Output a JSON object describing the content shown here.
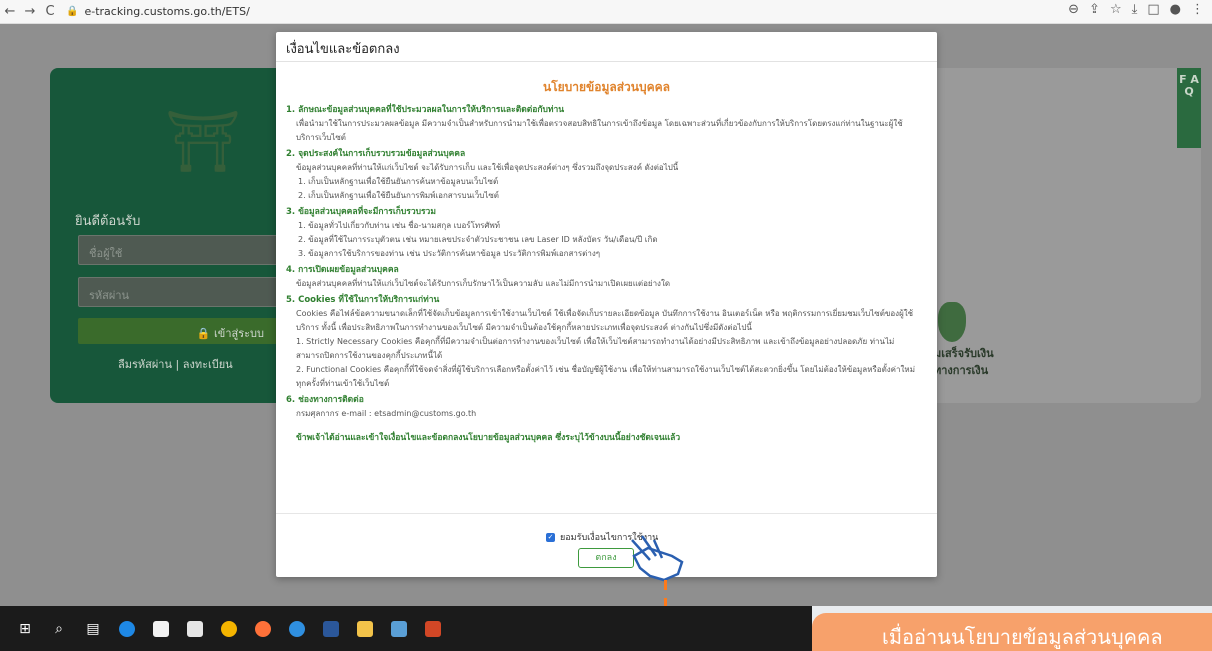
{
  "browser": {
    "back": "←",
    "forward": "→",
    "reload": "C",
    "lock": "🔒",
    "url": "e-tracking.customs.go.th/ETS/",
    "icons": [
      "⊖",
      "⇪",
      "☆",
      "⤓",
      "□",
      "●",
      "⋮"
    ]
  },
  "login": {
    "welcome": "ยินดีต้อนรับ",
    "username_placeholder": "ชื่อผู้ใช้",
    "password_placeholder": "รหัสผ่าน",
    "login_button": "🔒 เข้าสู่ระบบ",
    "forgot": "ลืมรหัสผ่าน  |  ลงทะเบียน"
  },
  "right_panel": {
    "faq": "F A Q",
    "money_text_1": "มเสร็จรับเงิน",
    "money_text_2": "ทางการเงิน"
  },
  "modal": {
    "title": "เงื่อนไขและข้อตกลง",
    "policy_title": "นโยบายข้อมูลส่วนบุคคล",
    "sections": [
      {
        "heading": "1. ลักษณะข้อมูลส่วนบุคคลที่ใช้ประมวลผลในการให้บริการและติดต่อกับท่าน",
        "paras": [
          "เพื่อนำมาใช้ในการประมวลผลข้อมูล มีความจำเป็นสำหรับการนำมาใช้เพื่อตรวจสอบสิทธิในการเข้าถึงข้อมูล โดยเฉพาะส่วนที่เกี่ยวข้องกับการให้บริการโดยตรงแก่ท่านในฐานะผู้ใช้",
          "บริการเว็บไซต์"
        ]
      },
      {
        "heading": "2. จุดประสงค์ในการเก็บรวบรวมข้อมูลส่วนบุคคล",
        "paras": [
          "ข้อมูลส่วนบุคคลที่ท่านให้แก่เว็บไซต์ จะได้รับการเก็บ และใช้เพื่อจุดประสงค์ต่างๆ ซึ่งรวมถึงจุดประสงค์ ดังต่อไปนี้",
          "1. เก็บเป็นหลักฐานเพื่อใช้ยืนยันการค้นหาข้อมูลบนเว็บไซต์",
          "2. เก็บเป็นหลักฐานเพื่อใช้ยืนยันการพิมพ์เอกสารบนเว็บไซต์"
        ]
      },
      {
        "heading": "3. ข้อมูลส่วนบุคคลที่จะมีการเก็บรวบรวม",
        "paras": [
          "1. ข้อมูลทั่วไปเกี่ยวกับท่าน เช่น ชื่อ-นามสกุล เบอร์โทรศัพท์",
          "2. ข้อมูลที่ใช้ในการระบุตัวตน เช่น หมายเลขประจำตัวประชาชน เลข Laser ID หลังบัตร วัน/เดือน/ปี เกิด",
          "3. ข้อมูลการใช้บริการของท่าน เช่น ประวัติการค้นหาข้อมูล ประวัติการพิมพ์เอกสารต่างๆ"
        ]
      },
      {
        "heading": "4. การเปิดเผยข้อมูลส่วนบุคคล",
        "paras": [
          "ข้อมูลส่วนบุคคลที่ท่านให้แก่เว็บไซต์จะได้รับการเก็บรักษาไว้เป็นความลับ และไม่มีการนำมาเปิดเผยแต่อย่างใด"
        ]
      },
      {
        "heading": "5. Cookies ที่ใช้ในการให้บริการแก่ท่าน",
        "paras": [
          "Cookies คือไฟล์ข้อความขนาดเล็กที่ใช้จัดเก็บข้อมูลการเข้าใช้งานเว็บไซต์ ใช้เพื่อจัดเก็บรายละเอียดข้อมูล บันทึกการใช้งาน อินเตอร์เน็ต หรือ พฤติกรรมการเยี่ยมชมเว็บไซต์ของผู้ใช้",
          "บริการ ทั้งนี้ เพื่อประสิทธิภาพในการทำงานของเว็บไซต์ มีความจำเป็นต้องใช้คุกกี้หลายประเภทเพื่อจุดประสงค์ ต่างกันไปซึ่งมีดังต่อไปนี้",
          "1. Strictly Necessary Cookies คือคุกกี้ที่มีความจำเป็นต่อการทำงานของเว็บไซต์ เพื่อให้เว็บไซต์สามารถทำงานได้อย่างมีประสิทธิภาพ และเข้าถึงข้อมูลอย่างปลอดภัย ท่านไม่",
          "สามารถปิดการใช้งานของคุกกี้ประเภทนี้ได้",
          "2. Functional Cookies คือคุกกี้ที่ใช้จดจำสิ่งที่ผู้ใช้บริการเลือกหรือตั้งค่าไว้ เช่น ชื่อบัญชีผู้ใช้งาน เพื่อให้ท่านสามารถใช้งานเว็บไซต์ได้สะดวกยิ่งขึ้น โดยไม่ต้องให้ข้อมูลหรือตั้งค่าใหม่",
          "ทุกครั้งที่ท่านเข้าใช้เว็บไซต์"
        ]
      },
      {
        "heading": "6. ช่องทางการติดต่อ",
        "paras": [
          "กรมศุลกากร e-mail : etsadmin@customs.go.th"
        ]
      }
    ],
    "agree_note": "ข้าพเจ้าได้อ่านและเข้าใจเงื่อนไขและข้อตกลงนโยบายข้อมูลส่วนบุคคล ซึ่งระบุไว้ข้างบนนี้อย่างชัดเจนแล้ว",
    "accept_label": "ยอมรับเงื่อนไขการใช้งาน",
    "ok_button": "ตกลง"
  },
  "callout": {
    "text": "เมื่ออ่านนโยบายข้อมูลส่วนบุคคล"
  },
  "colors": {
    "accent_orange": "#f7a16b",
    "policy_green": "#2f7f2f",
    "policy_orange": "#e0832c"
  }
}
